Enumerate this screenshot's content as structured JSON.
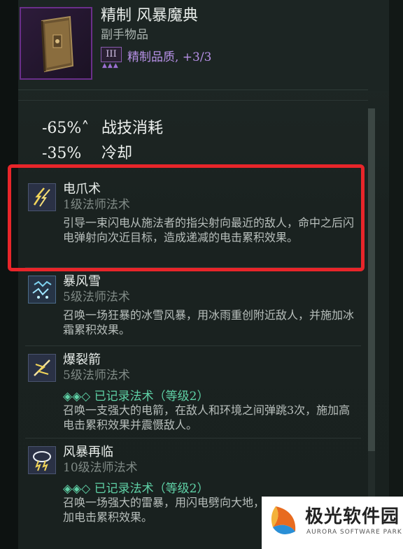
{
  "item": {
    "title": "精制 风暴魔典",
    "subtitle": "副手物品",
    "tier": "III",
    "quality": "精制品质, +3/3",
    "icon": "grimoire-book-icon"
  },
  "stats": [
    {
      "value": "-65%˄",
      "label": "战技消耗"
    },
    {
      "value": "-35%",
      "label": "冷却"
    }
  ],
  "spells": [
    {
      "name": "电爪术",
      "level": "1级法师法术",
      "recorded": "",
      "description": "引导一束闪电从施法者的指尖射向最近的敌人，命中之后闪电弹射向次近目标，造成递减的电击累积效果。",
      "icon": "lightning-claw-icon"
    },
    {
      "name": "暴风雪",
      "level": "5级法师法术",
      "recorded": "",
      "description": "召唤一场狂暴的冰雪风暴，用冰雨重创附近敌人，并施加冰霜累积效果。",
      "icon": "blizzard-icon"
    },
    {
      "name": "爆裂箭",
      "level": "5级法师法术",
      "recorded": "◈◈◇ 已记录法术（等级2）",
      "description": "召唤一支强大的电箭，在敌人和环境之间弹跳3次，施加高电击累积效果并震慑敌人。",
      "icon": "chain-bolt-icon"
    },
    {
      "name": "风暴再临",
      "level": "10级法师法术",
      "recorded": "◈◈◇ 已记录法术（等级2）",
      "description": "召唤一场强大的雷暴，用闪电劈向大地，震慑附近敌人并施加电击累积效果。",
      "icon": "storm-cloud-icon"
    }
  ],
  "watermark": {
    "name": "极光软件园",
    "english": "AURORA SOFTWARE PARK"
  },
  "colors": {
    "highlight": "#e8252a",
    "recorded": "#5fd1a6",
    "quality": "#b690e6"
  }
}
